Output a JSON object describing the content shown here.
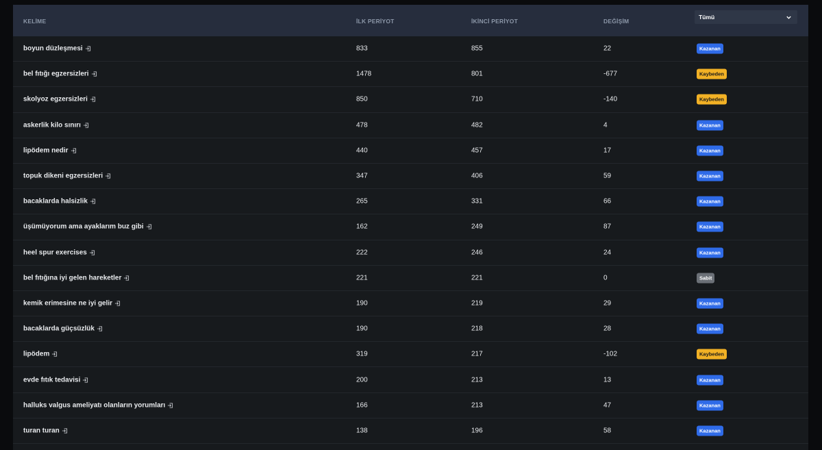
{
  "table": {
    "headers": {
      "keyword": "KELİME",
      "first_period": "İLK PERİYOT",
      "second_period": "İKİNCİ PERİYOT",
      "change": "DEĞİŞİM"
    },
    "filter": {
      "selected": "Tümü"
    },
    "rows": [
      {
        "keyword": "boyun düzleşmesi",
        "first": "833",
        "second": "855",
        "change": "22",
        "status": "Kazanan",
        "type": "win"
      },
      {
        "keyword": "bel fıtığı egzersizleri",
        "first": "1478",
        "second": "801",
        "change": "-677",
        "status": "Kaybeden",
        "type": "lose"
      },
      {
        "keyword": "skolyoz egzersizleri",
        "first": "850",
        "second": "710",
        "change": "-140",
        "status": "Kaybeden",
        "type": "lose"
      },
      {
        "keyword": "askerlik kilo sınırı",
        "first": "478",
        "second": "482",
        "change": "4",
        "status": "Kazanan",
        "type": "win"
      },
      {
        "keyword": "lipödem nedir",
        "first": "440",
        "second": "457",
        "change": "17",
        "status": "Kazanan",
        "type": "win"
      },
      {
        "keyword": "topuk dikeni egzersizleri",
        "first": "347",
        "second": "406",
        "change": "59",
        "status": "Kazanan",
        "type": "win"
      },
      {
        "keyword": "bacaklarda halsizlik",
        "first": "265",
        "second": "331",
        "change": "66",
        "status": "Kazanan",
        "type": "win"
      },
      {
        "keyword": "üşümüyorum ama ayaklarım buz gibi",
        "first": "162",
        "second": "249",
        "change": "87",
        "status": "Kazanan",
        "type": "win"
      },
      {
        "keyword": "heel spur exercises",
        "first": "222",
        "second": "246",
        "change": "24",
        "status": "Kazanan",
        "type": "win"
      },
      {
        "keyword": "bel fıtığına iyi gelen hareketler",
        "first": "221",
        "second": "221",
        "change": "0",
        "status": "Sabit",
        "type": "flat"
      },
      {
        "keyword": "kemik erimesine ne iyi gelir",
        "first": "190",
        "second": "219",
        "change": "29",
        "status": "Kazanan",
        "type": "win"
      },
      {
        "keyword": "bacaklarda güçsüzlük",
        "first": "190",
        "second": "218",
        "change": "28",
        "status": "Kazanan",
        "type": "win"
      },
      {
        "keyword": "lipödem",
        "first": "319",
        "second": "217",
        "change": "-102",
        "status": "Kaybeden",
        "type": "lose"
      },
      {
        "keyword": "evde fıtık tedavisi",
        "first": "200",
        "second": "213",
        "change": "13",
        "status": "Kazanan",
        "type": "win"
      },
      {
        "keyword": "halluks valgus ameliyatı olanların yorumları",
        "first": "166",
        "second": "213",
        "change": "47",
        "status": "Kazanan",
        "type": "win"
      },
      {
        "keyword": "turan turan",
        "first": "138",
        "second": "196",
        "change": "58",
        "status": "Kazanan",
        "type": "win"
      }
    ]
  },
  "icons": {
    "keyword_link": "external-link-icon",
    "dropdown": "chevron-down-icon"
  },
  "colors": {
    "win": "#2f6be8",
    "lose": "#f2b125",
    "flat": "#6b7077",
    "header_bg": "#262d3d"
  }
}
